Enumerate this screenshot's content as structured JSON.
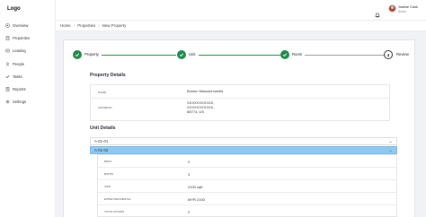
{
  "sidebar": {
    "logo": "Logo",
    "items": [
      {
        "label": "Overview",
        "icon": "overview-icon"
      },
      {
        "label": "Properties",
        "icon": "building-icon"
      },
      {
        "label": "Leasing",
        "icon": "leasing-icon"
      },
      {
        "label": "People",
        "icon": "people-icon"
      },
      {
        "label": "Tasks",
        "icon": "tasks-icon"
      },
      {
        "label": "Reports",
        "icon": "reports-icon"
      },
      {
        "label": "Settings",
        "icon": "gear-icon"
      }
    ]
  },
  "header": {
    "user_name": "Justine Clark",
    "user_role": "Admin"
  },
  "breadcrumb": [
    "Home",
    "Properties",
    "New Property"
  ],
  "stepper": {
    "steps": [
      {
        "label": "Property",
        "status": "done"
      },
      {
        "label": "Unit",
        "status": "done"
      },
      {
        "label": "Room",
        "status": "done"
      },
      {
        "label": "Review",
        "status": "current",
        "number": "4"
      }
    ]
  },
  "property_details": {
    "title": "Property Details",
    "name_label": "NAME",
    "name_value": "Boston Massachusetts",
    "address_label": "ADDRESS",
    "address_lines": [
      "XXXXXXXXXXX,",
      "XXXXXXXXXXX,",
      "68774, US"
    ]
  },
  "unit_details": {
    "title": "Unit Details",
    "units": [
      {
        "label": "A-01-01",
        "expanded": false
      },
      {
        "label": "A-01-02",
        "expanded": true
      }
    ],
    "fields": [
      {
        "label": "BEDS",
        "value": "2"
      },
      {
        "label": "BATHS",
        "value": "3"
      },
      {
        "label": "SIZE",
        "value": "2100 sqft"
      },
      {
        "label": "EXPECTED RENTAL",
        "value": "MYR 2100"
      },
      {
        "label": "TOTAL ROOMS",
        "value": "2"
      }
    ]
  },
  "colors": {
    "success": "#1f8a4c",
    "active_row": "#8fc8f0",
    "content_bg": "#f1f2f5"
  }
}
